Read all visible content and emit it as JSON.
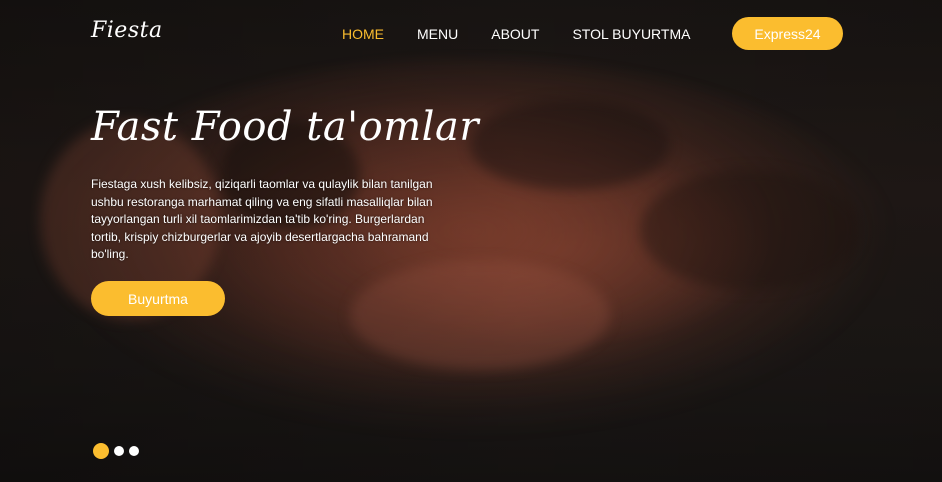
{
  "brand": {
    "name": "Fiesta"
  },
  "nav": {
    "items": [
      {
        "label": "HOME",
        "active": true
      },
      {
        "label": "MENU",
        "active": false
      },
      {
        "label": "ABOUT",
        "active": false
      },
      {
        "label": "STOL BUYURTMA",
        "active": false
      }
    ]
  },
  "header": {
    "express_label": "Express24"
  },
  "hero": {
    "title": "Fast Food ta'omlar",
    "description": "Fiestaga xush kelibsiz, qiziqarli taomlar va qulaylik bilan tanilgan ushbu restoranga marhamat qiling va eng sifatli masalliqlar bilan tayyorlangan turli xil taomlarimizdan ta'tib ko'ring. Burgerlardan tortib, krispiy chizburgerlar va ajoyib desertlargacha bahramand bo'ling.",
    "order_label": "Buyurtma"
  },
  "carousel": {
    "slides": 3,
    "active_index": 0
  },
  "colors": {
    "accent": "#fbbd2f",
    "text": "#ffffff"
  }
}
